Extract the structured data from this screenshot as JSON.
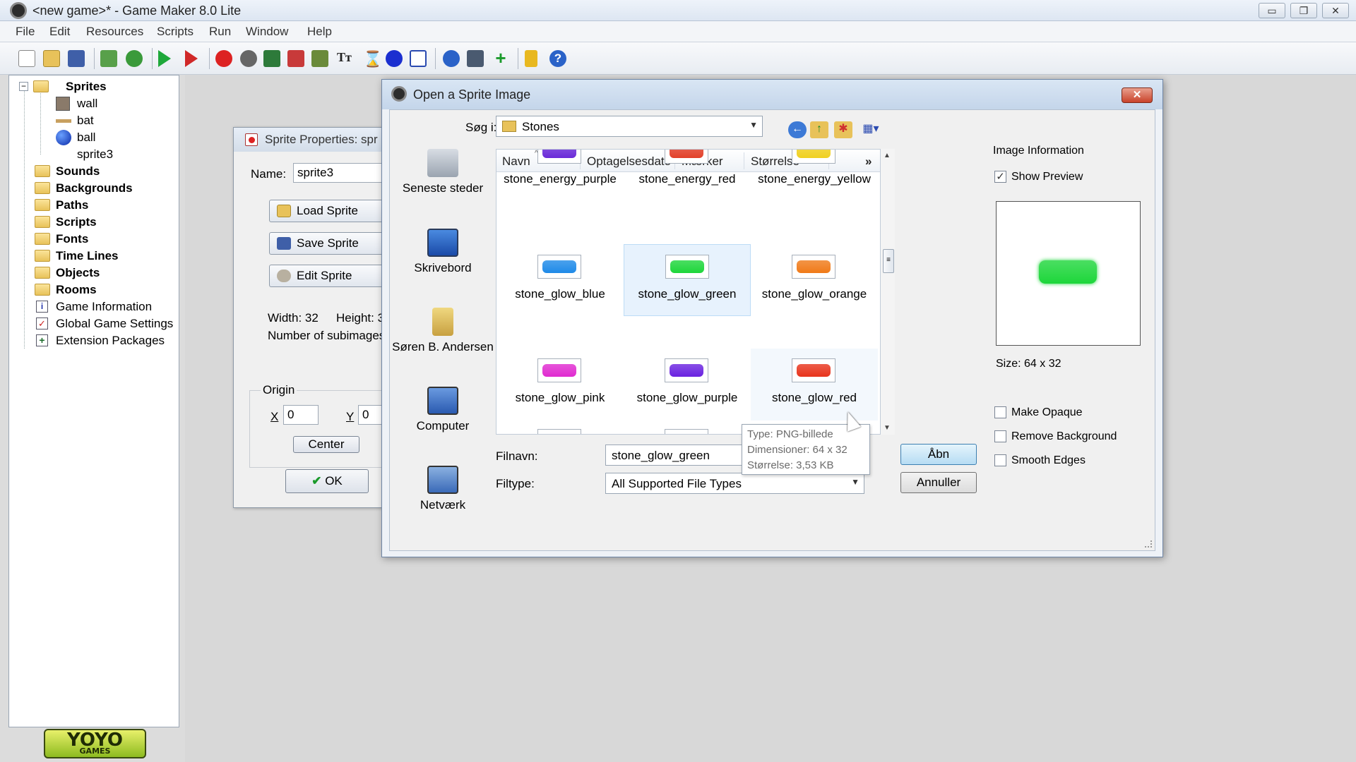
{
  "window": {
    "title": "<new game>* - Game Maker 8.0 Lite",
    "controls": {
      "minimize": "▭",
      "maximize": "❐",
      "close": "✕"
    }
  },
  "menu": [
    "File",
    "Edit",
    "Resources",
    "Scripts",
    "Run",
    "Window",
    "Help"
  ],
  "toolbar_icons": [
    "new-icon",
    "open-icon",
    "save-icon",
    "export-icon",
    "publish-icon",
    "run-icon",
    "debug-icon",
    "add-sprite-icon",
    "add-sound-icon",
    "add-background-icon",
    "add-path-icon",
    "add-script-icon",
    "add-font-icon",
    "add-timeline-icon",
    "add-object-icon",
    "add-room-icon",
    "game-info-icon",
    "game-settings-icon",
    "extension-icon",
    "upgrade-icon",
    "help-icon"
  ],
  "tree": {
    "sprites": "Sprites",
    "sprite_items": [
      "wall",
      "bat",
      "ball",
      "sprite3"
    ],
    "folders": [
      "Sounds",
      "Backgrounds",
      "Paths",
      "Scripts",
      "Fonts",
      "Time Lines",
      "Objects",
      "Rooms"
    ],
    "leaves": [
      "Game Information",
      "Global Game Settings",
      "Extension Packages"
    ]
  },
  "logo": {
    "main": "YOYO",
    "sub": "GAMES"
  },
  "sprite_props": {
    "title": "Sprite Properties: spr",
    "name_label": "Name:",
    "name_value": "sprite3",
    "load": "Load Sprite",
    "save": "Save Sprite",
    "edit": "Edit Sprite",
    "width": "Width: 32",
    "height": "Height: 3",
    "subimages": "Number of subimages:",
    "origin": "Origin",
    "x_label": "X",
    "x_value": "0",
    "y_label": "Y",
    "y_value": "0",
    "center": "Center",
    "ok": "OK"
  },
  "dialog": {
    "title": "Open a Sprite Image",
    "look_in_label": "Søg i:",
    "look_in_value": "Stones",
    "places": [
      "Seneste steder",
      "Skrivebord",
      "Søren B. Andersen",
      "Computer",
      "Netværk"
    ],
    "columns": [
      "Navn",
      "Optagelsesdato",
      "Mærker",
      "Størrelse"
    ],
    "more_columns": "»",
    "files": [
      {
        "name": "stone_energy_purple",
        "color": "#6a2ad8"
      },
      {
        "name": "stone_energy_red",
        "color": "#e2402a"
      },
      {
        "name": "stone_energy_yellow",
        "color": "#f0d020"
      },
      {
        "name": "stone_glow_blue",
        "color": "#1e8ae8"
      },
      {
        "name": "stone_glow_green",
        "color": "#1dd63a"
      },
      {
        "name": "stone_glow_orange",
        "color": "#f07a18"
      },
      {
        "name": "stone_glow_pink",
        "color": "#e02ad0"
      },
      {
        "name": "stone_glow_purple",
        "color": "#6a22e0"
      },
      {
        "name": "stone_glow_red",
        "color": "#e8341c"
      }
    ],
    "partial_row_colors": [
      "#f0d020",
      "#1e5ac8",
      "#20b040"
    ],
    "tooltip": {
      "type": "Type: PNG-billede",
      "dims": "Dimensioner: 64 x 32",
      "size": "Størrelse: 3,53 KB"
    },
    "filename_label": "Filnavn:",
    "filename_value": "stone_glow_green",
    "filetype_label": "Filtype:",
    "filetype_value": "All Supported File Types",
    "open": "Åbn",
    "cancel": "Annuller"
  },
  "image_info": {
    "title": "Image Information",
    "show_preview": "Show Preview",
    "show_preview_checked": true,
    "size": "Size: 64 x 32",
    "make_opaque": "Make Opaque",
    "remove_background": "Remove Background",
    "smooth_edges": "Smooth Edges",
    "preview_color": "#1dd63a"
  }
}
